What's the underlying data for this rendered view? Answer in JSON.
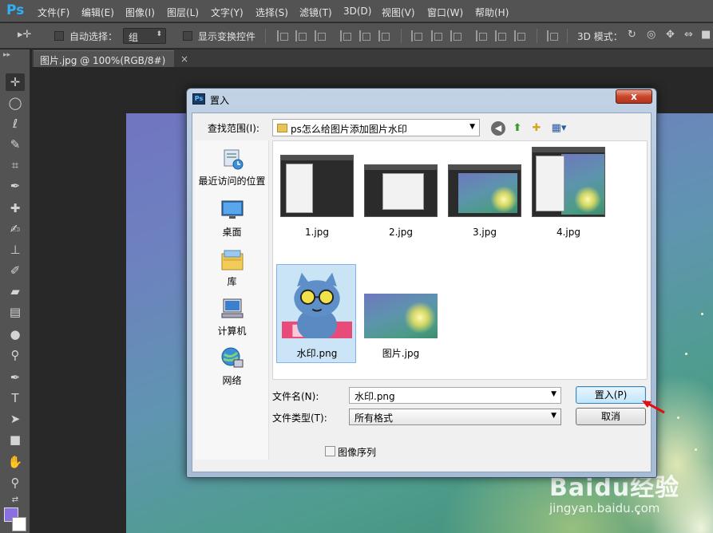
{
  "app": {
    "logo": "Ps",
    "menu": [
      "文件(F)",
      "编辑(E)",
      "图像(I)",
      "图层(L)",
      "文字(Y)",
      "选择(S)",
      "滤镜(T)",
      "3D(D)",
      "视图(V)",
      "窗口(W)",
      "帮助(H)"
    ]
  },
  "options_bar": {
    "auto_select_label": "自动选择：",
    "auto_select_value": "组",
    "show_transform_label": "显示变换控件",
    "mode_3d_label": "3D 模式："
  },
  "document_tab": {
    "title": "图片.jpg @ 100%(RGB/8#)",
    "close": "×"
  },
  "dialog": {
    "title": "置入",
    "close_glyph": "x",
    "look_in_label": "查找范围(I):",
    "look_in_value": "ps怎么给图片添加图片水印",
    "places": [
      {
        "label": "最近访问的位置",
        "icon": "recent-places-icon"
      },
      {
        "label": "桌面",
        "icon": "desktop-icon"
      },
      {
        "label": "库",
        "icon": "libraries-icon"
      },
      {
        "label": "计算机",
        "icon": "computer-icon"
      },
      {
        "label": "网络",
        "icon": "network-icon"
      }
    ],
    "files": [
      {
        "name": "1.jpg",
        "kind": "screenshot"
      },
      {
        "name": "2.jpg",
        "kind": "screenshot"
      },
      {
        "name": "3.jpg",
        "kind": "nature-screenshot"
      },
      {
        "name": "4.jpg",
        "kind": "screenshot"
      },
      {
        "name": "水印.png",
        "kind": "cat",
        "selected": true
      },
      {
        "name": "图片.jpg",
        "kind": "nature"
      }
    ],
    "file_name_label": "文件名(N):",
    "file_name_value": "水印.png",
    "file_type_label": "文件类型(T):",
    "file_type_value": "所有格式",
    "place_button": "置入(P)",
    "cancel_button": "取消",
    "image_sequence_label": "图像序列"
  },
  "watermark": {
    "logo": "Baidu经验",
    "url": "jingyan.baidu.com"
  },
  "colors": {
    "foreground": "#8a6fe0",
    "background": "#ffffff",
    "accent_arrow": "#e01010"
  }
}
